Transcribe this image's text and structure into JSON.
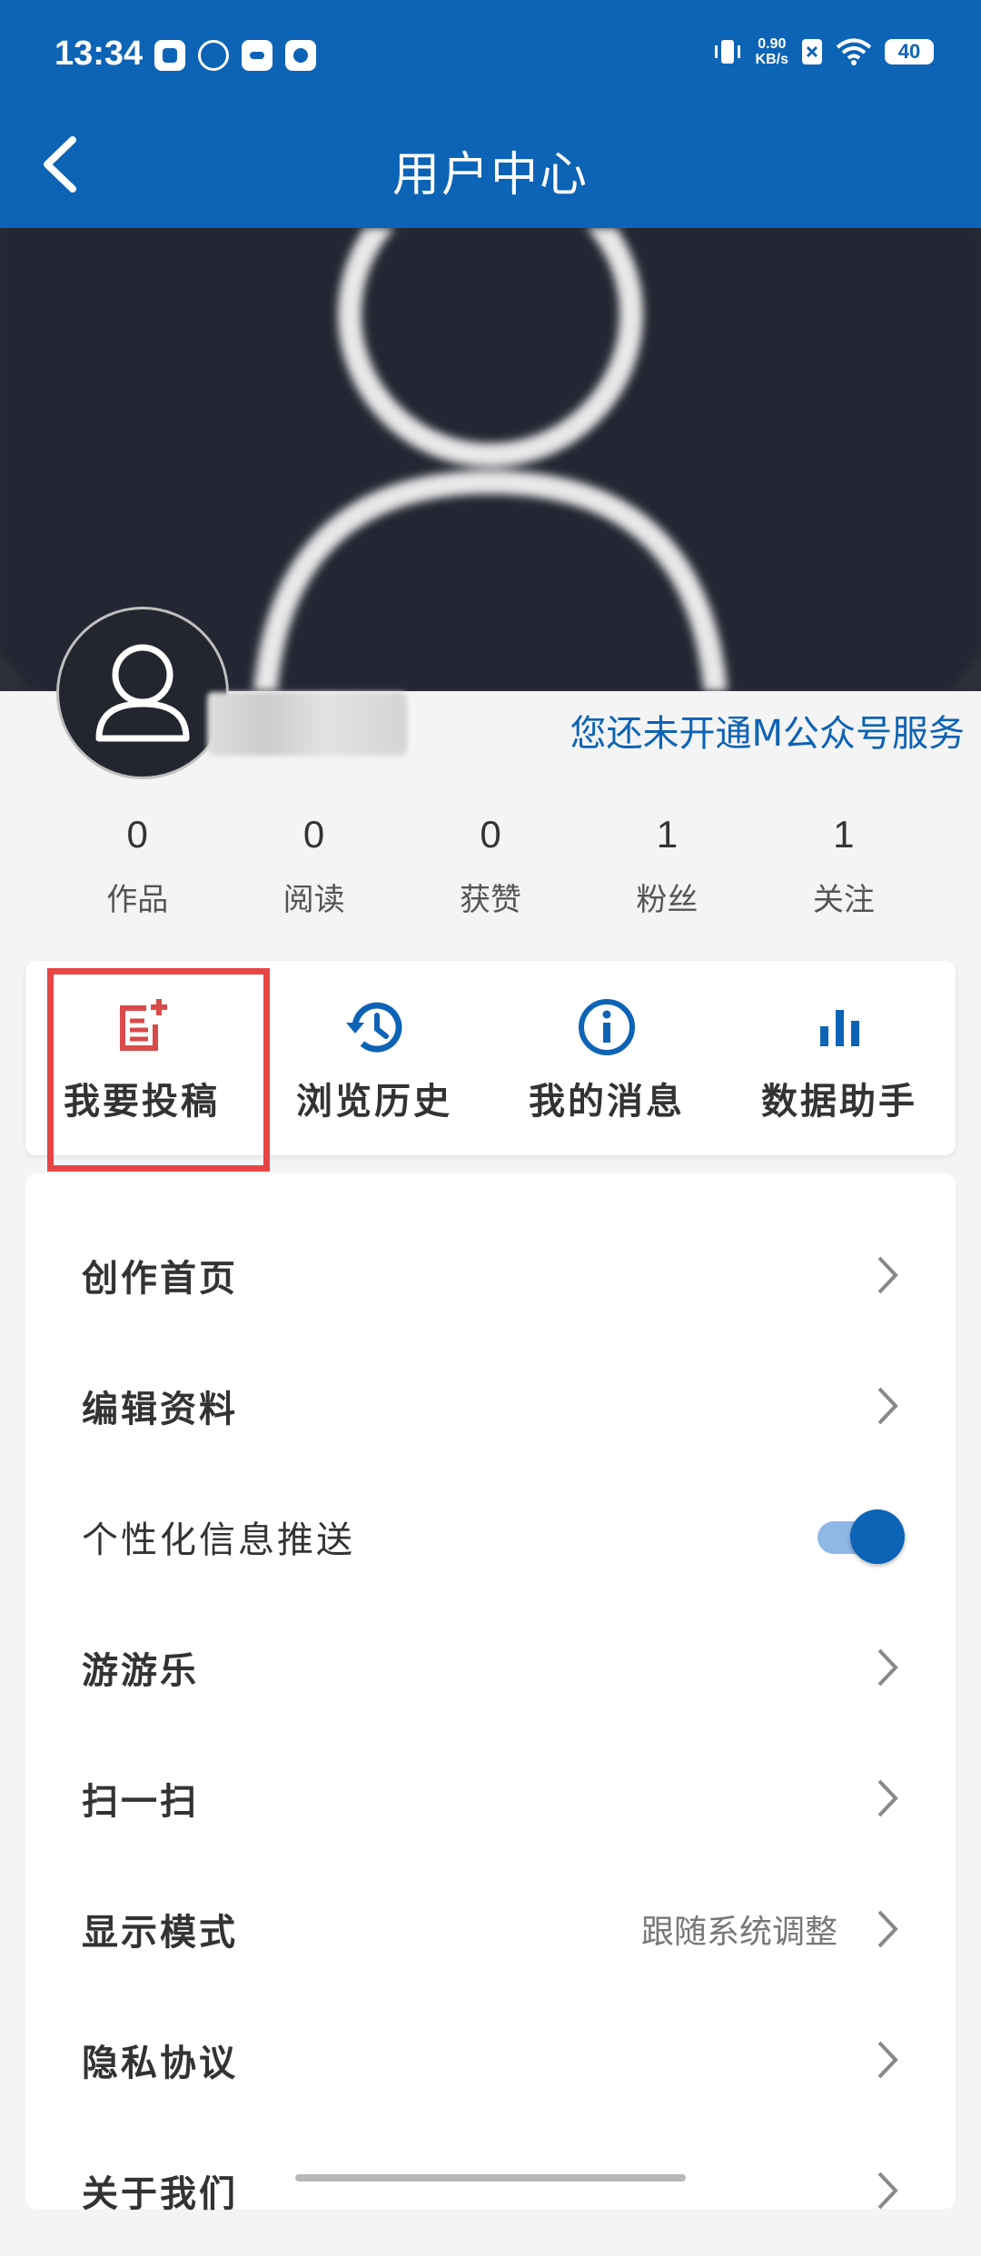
{
  "status_bar": {
    "time": "13:34",
    "net_speed_value": "0.90",
    "net_speed_unit": "KB/s",
    "battery": "40"
  },
  "header": {
    "title": "用户中心",
    "back_icon": "chevron-left-icon"
  },
  "profile": {
    "service_link": "您还未开通M公众号服务",
    "stats": [
      {
        "value": "0",
        "label": "作品"
      },
      {
        "value": "0",
        "label": "阅读"
      },
      {
        "value": "0",
        "label": "获赞"
      },
      {
        "value": "1",
        "label": "粉丝"
      },
      {
        "value": "1",
        "label": "关注"
      }
    ]
  },
  "quick_actions": [
    {
      "label": "我要投稿",
      "icon": "post-article-icon",
      "color": "#d94a4a"
    },
    {
      "label": "浏览历史",
      "icon": "history-icon",
      "color": "#0d63b5"
    },
    {
      "label": "我的消息",
      "icon": "info-icon",
      "color": "#0d63b5"
    },
    {
      "label": "数据助手",
      "icon": "bar-chart-icon",
      "color": "#0d63b5"
    }
  ],
  "menu": {
    "items": [
      {
        "label": "创作首页"
      },
      {
        "label": "编辑资料"
      },
      {
        "label": "个性化信息推送",
        "toggle": true
      },
      {
        "label": "游游乐"
      },
      {
        "label": "扫一扫"
      },
      {
        "label": "显示模式",
        "value": "跟随系统调整"
      },
      {
        "label": "隐私协议"
      },
      {
        "label": "关于我们"
      }
    ]
  },
  "colors": {
    "brand": "#0d63b5",
    "highlight": "#e84545"
  }
}
